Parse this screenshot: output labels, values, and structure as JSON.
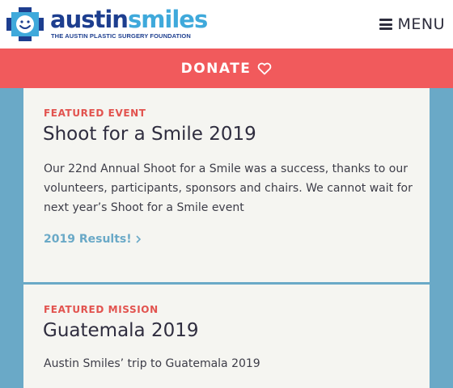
{
  "header": {
    "logo_word_1": "austin",
    "logo_word_2": "smiles",
    "logo_tagline": "THE AUSTIN PLASTIC SURGERY FOUNDATION",
    "logo_icon": "cross-smile-icon",
    "menu_icon": "hamburger-icon",
    "menu_label": "MENU"
  },
  "donate": {
    "label": "DONATE",
    "icon": "heart-outline-icon"
  },
  "cards": [
    {
      "kicker": "FEATURED EVENT",
      "title": "Shoot for a Smile 2019",
      "text": "Our 22nd Annual Shoot for a Smile was a success, thanks to our volunteers, participants, sponsors and chairs. We cannot wait for next year’s Shoot for a Smile event",
      "link_label": "2019 Results!",
      "link_icon": "chevron-right-icon"
    },
    {
      "kicker": "FEATURED MISSION",
      "title": "Guatemala 2019",
      "text": "Austin Smiles’ trip to Guatemala 2019"
    }
  ],
  "colors": {
    "brand_navy": "#1d3e8f",
    "brand_blue": "#3fa9db",
    "donate_red": "#f15a5c",
    "kicker_red": "#e2534f",
    "page_bg": "#6aa9c7",
    "card_bg": "#f5f5f1"
  }
}
